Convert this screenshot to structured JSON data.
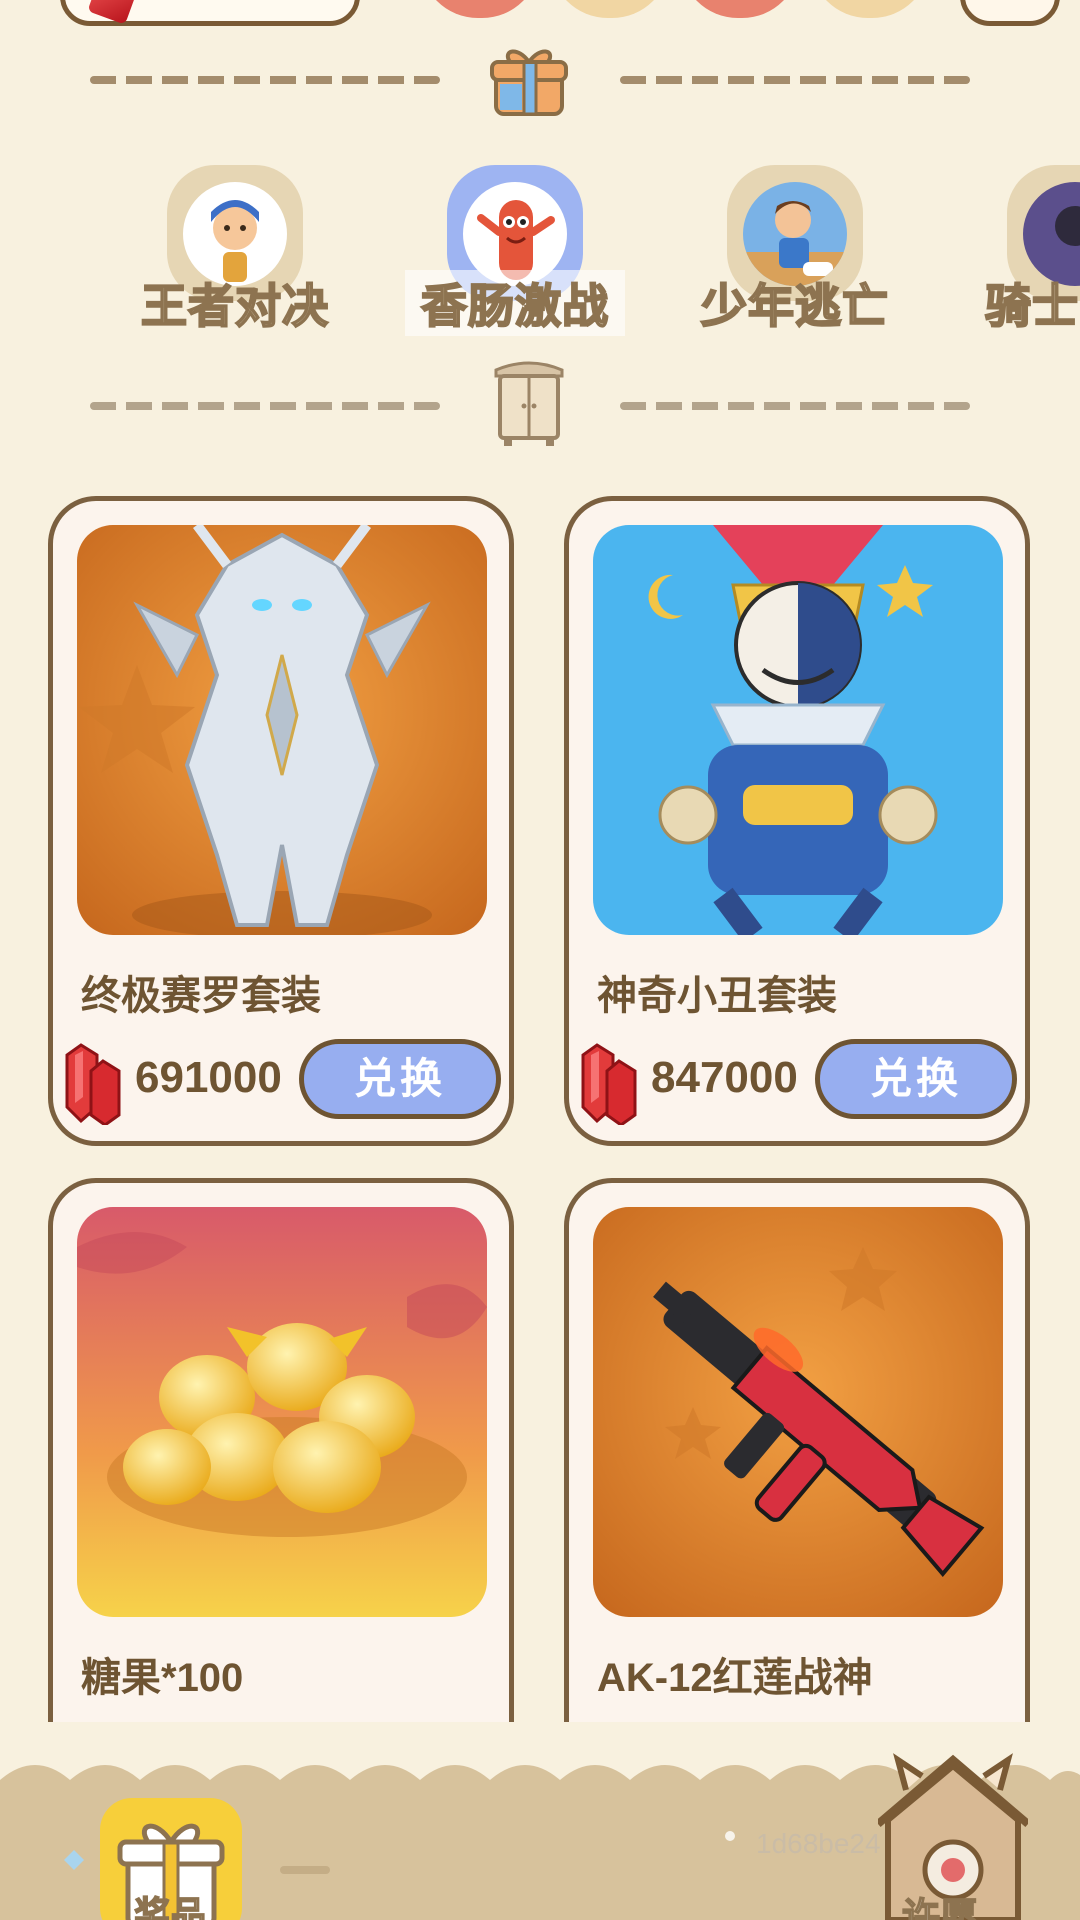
{
  "games": [
    {
      "label": "王者对决",
      "active": false
    },
    {
      "label": "香肠激战",
      "active": true
    },
    {
      "label": "少年逃亡",
      "active": false
    },
    {
      "label": "骑士",
      "active": false
    }
  ],
  "products": [
    {
      "name": "终极赛罗套装",
      "price": "691000",
      "button": "兑换"
    },
    {
      "name": "神奇小丑套装",
      "price": "847000",
      "button": "兑换"
    },
    {
      "name": "糖果*100"
    },
    {
      "name": "AK-12红莲战神"
    }
  ],
  "bottom_nav": {
    "prize_label": "奖品",
    "home_label": "许愿",
    "watermark": "1d68be24"
  },
  "colors": {
    "background": "#f8f1df",
    "card_border": "#7b6040",
    "redeem_button": "#97aef0",
    "active_game_ring": "#9eb4f2"
  }
}
